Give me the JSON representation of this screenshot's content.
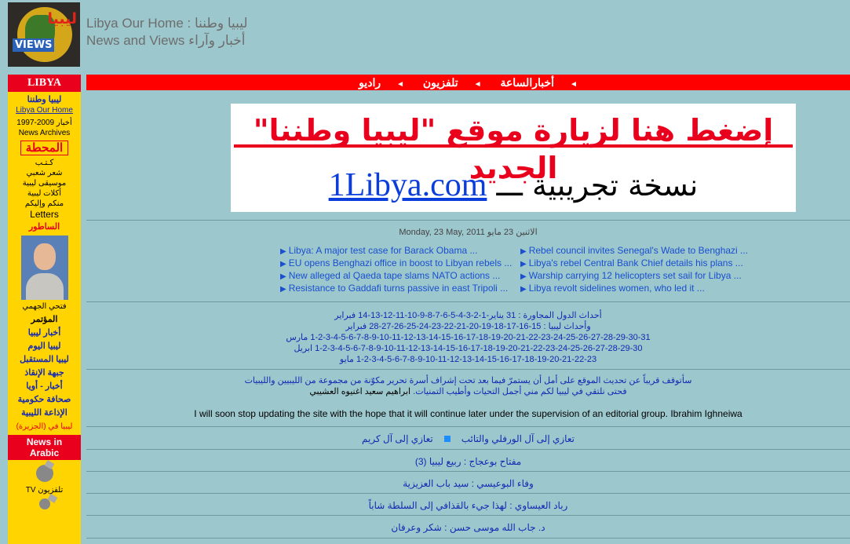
{
  "header": {
    "logo_text_ar": "ليبيا",
    "logo_text_en": "VIEWS",
    "title_line1": "Libya Our Home  : ليبيا وطننا",
    "title_line2": "News and Views  أخبار وآراء"
  },
  "sidebar": {
    "top_label": "LIBYA",
    "items": [
      {
        "text": "ليبيا وطننا",
        "style": "blue"
      },
      {
        "text": "Libya Our Home",
        "style": "link"
      },
      {
        "text": "1997-2009 أخبار",
        "style": "plain"
      },
      {
        "text": "News Archives",
        "style": "plain"
      },
      {
        "text": "المحطة",
        "style": "box"
      },
      {
        "text": "كـتـب",
        "style": "plain"
      },
      {
        "text": "شعر شعبي",
        "style": "plain"
      },
      {
        "text": "موسيقى ليبية",
        "style": "plain"
      },
      {
        "text": "أكلات ليبية",
        "style": "plain"
      },
      {
        "text": "منكم وإليكم",
        "style": "plain"
      },
      {
        "text": "Letters",
        "style": "plain-large"
      },
      {
        "text": "الساطور",
        "style": "red"
      }
    ],
    "photo_caption": "فتحي الجهمي",
    "items2": [
      {
        "text": "المؤتمر",
        "style": "blk"
      },
      {
        "text": "أخبار ليبيا",
        "style": "blue"
      },
      {
        "text": "ليبيا اليوم",
        "style": "blue"
      },
      {
        "text": "ليبيا المستقبل",
        "style": "blue"
      },
      {
        "text": "جبهة الإنقاذ",
        "style": "blue"
      },
      {
        "text": "أخبار - أويا",
        "style": "blue"
      },
      {
        "text": "صحافة حكومية",
        "style": "blue"
      },
      {
        "text": "الإذاعة الليبية",
        "style": "blue"
      },
      {
        "text": "ليبيا في (الجزيرة)",
        "style": "red-small"
      }
    ],
    "news_arabic_line1": "News in",
    "news_arabic_line2": "Arabic",
    "tv_label": "TV تلفزيون"
  },
  "topnav": {
    "items": [
      "أخبارالساعة",
      "تلفزيون",
      "راديو"
    ]
  },
  "banner": {
    "line1": "إضغط هنا لزيارة موقع \"ليبيا وطننا\" الجديد",
    "line2_ar": "نسخة تجريبية ـــ",
    "line2_domain": "1Libya.com"
  },
  "date": "Monday, 23 May, 2011  الاثنين 23 مايو",
  "headlines_left": [
    "Libya: A major test case for Barack Obama ...",
    "EU opens Benghazi office in boost to Libyan rebels ...",
    "New alleged al Qaeda tape slams NATO actions ...",
    "Resistance to Gaddafi turns passive in east Tripoli ..."
  ],
  "headlines_right": [
    "Rebel council invites Senegal's Wade to Benghazi ...",
    "Libya's rebel Central Bank Chief details his plans ...",
    "Warship carrying 12 helicopters set sail for Libya ...",
    "Libya revolt sidelines women, who led it ..."
  ],
  "date_lines": [
    "أحداث الدول المجاورة : 31 يناير-1-2-3-4-5-6-7-8-9-10-11-12-13-14 فبراير",
    "وأحداث ليبيا : 15-16-17-18-19-20-21-22-23-24-25-26-27-28 فبراير",
    "1-2-3-4-5-6-7-8-9-10-11-12-13-14-15-16-17-18-19-20-21-22-23-24-25-26-27-28-29-30-31 مارس",
    "1-2-3-4-5-6-7-8-9-10-11-12-13-14-15-16-17-18-19-20-21-22-23-24-25-26-27-28-29-30 ابريل",
    "1-2-3-4-5-6-7-8-9-10-11-12-13-14-15-16-17-18-19-20-21-22-23 مايو"
  ],
  "notice": {
    "line1": "سأتوقف قريباً عن تحديث الموقع على أمل أن يستمرّ فيما بعد تحت إشراف أسرة تحرير مكوّنة من مجموعة من الليبيين والليبيات",
    "line2": "فحتى نلتقي في ليبيا لكم مني أجمل التحيات وأطيب التمنيات.",
    "signature": "ابراهيم سعيد اغنيوه العشيبي"
  },
  "english_notice": "I will soon stop updating the site with the hope that it will continue later under the supervision of an editorial group. Ibrahim Ighneiwa",
  "articles": [
    {
      "left": "تعازي إلى آل الورفلي والتائب",
      "right": "تعازي إلى آل كريم"
    },
    {
      "left": "مفتاح بوعجاج : ربيع ليبيا (3)"
    },
    {
      "left": "وفاء البوعيسي : سيد باب العزيزية"
    },
    {
      "left": "رباد العيساوي : لهذا جيء بالقذافي إلى السلطة شاباً"
    },
    {
      "left": "د. جاب الله موسى حسن : شكر وعرفان"
    }
  ]
}
